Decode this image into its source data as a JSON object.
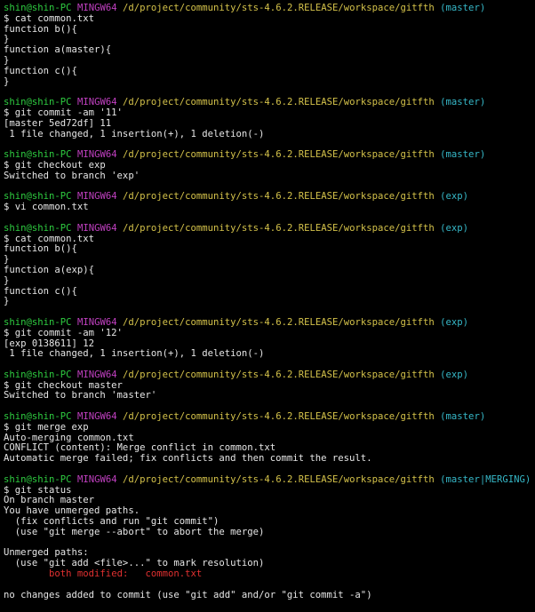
{
  "terminal": {
    "prompt": {
      "user_host": "shin@shin-PC",
      "system": "MINGW64",
      "path": "/d/project/community/sts-4.6.2.RELEASE/workspace/gitfth"
    },
    "colors": {
      "background": "#000000",
      "text": "#e6e6e6",
      "user_host": "#2ecc40",
      "system": "#c040c0",
      "path": "#d4c24a",
      "branch": "#36b8c8",
      "conflict_file": "#e03030"
    },
    "blocks": [
      {
        "branch": "(master)",
        "command": "$ cat common.txt",
        "output": [
          "function b(){",
          "}",
          "function a(master){",
          "}",
          "function c(){",
          "}"
        ]
      },
      {
        "branch": "(master)",
        "command": "$ git commit -am '11'",
        "output": [
          "[master 5ed72df] 11",
          " 1 file changed, 1 insertion(+), 1 deletion(-)"
        ]
      },
      {
        "branch": "(master)",
        "command": "$ git checkout exp",
        "output": [
          "Switched to branch 'exp'"
        ]
      },
      {
        "branch": "(exp)",
        "command": "$ vi common.txt",
        "output": []
      },
      {
        "branch": "(exp)",
        "command": "$ cat common.txt",
        "output": [
          "function b(){",
          "}",
          "function a(exp){",
          "}",
          "function c(){",
          "}"
        ]
      },
      {
        "branch": "(exp)",
        "command": "$ git commit -am '12'",
        "output": [
          "[exp 0138611] 12",
          " 1 file changed, 1 insertion(+), 1 deletion(-)"
        ]
      },
      {
        "branch": "(exp)",
        "command": "$ git checkout master",
        "output": [
          "Switched to branch 'master'"
        ]
      },
      {
        "branch": "(master)",
        "command": "$ git merge exp",
        "output": [
          "Auto-merging common.txt",
          "CONFLICT (content): Merge conflict in common.txt",
          "Automatic merge failed; fix conflicts and then commit the result."
        ]
      },
      {
        "branch": "(master|MERGING)",
        "command": "$ git status",
        "output": [
          "On branch master",
          "You have unmerged paths.",
          "  (fix conflicts and run \"git commit\")",
          "  (use \"git merge --abort\" to abort the merge)",
          "",
          "Unmerged paths:",
          "  (use \"git add <file>...\" to mark resolution)"
        ],
        "conflict_line": {
          "indent": "        ",
          "label": "both modified:",
          "gap": "   ",
          "file": "common.txt"
        },
        "after_output": [
          "",
          "no changes added to commit (use \"git add\" and/or \"git commit -a\")"
        ]
      }
    ]
  }
}
